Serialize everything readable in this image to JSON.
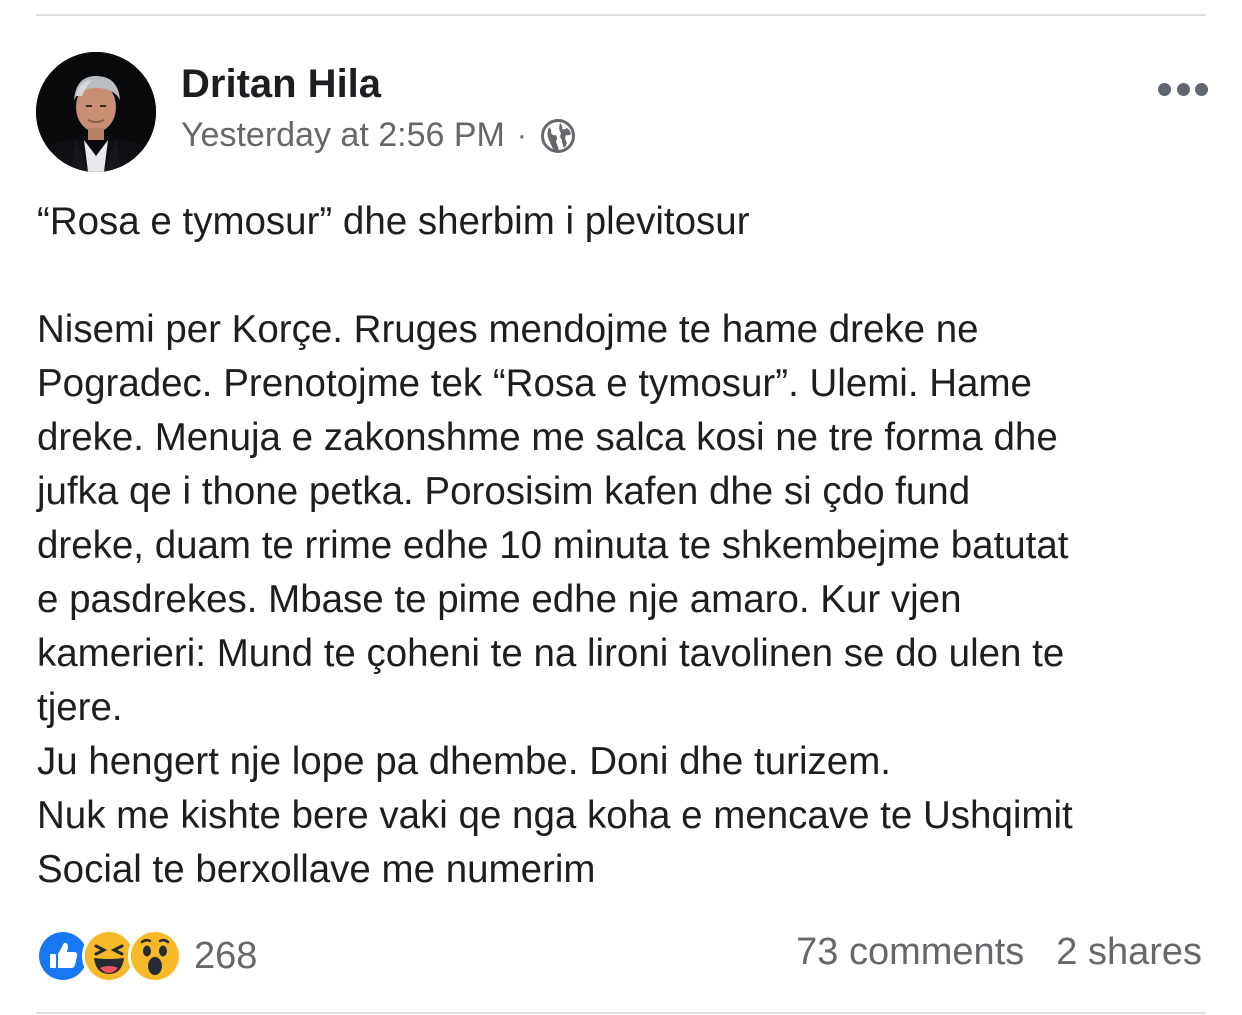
{
  "post": {
    "author": "Dritan Hila",
    "timestamp": "Yesterday at 2:56 PM",
    "separator": "·",
    "audience_icon": "globe-icon",
    "more_icon": "more-options-icon",
    "body": {
      "title_line": "“Rosa e tymosur” dhe sherbim i plevitosur",
      "lines": [
        "Nisemi per Korçe. Rruges mendojme te hame dreke ne",
        "Pogradec. Prenotojme tek “Rosa e tymosur”. Ulemi. Hame",
        "dreke. Menuja e zakonshme me salca kosi ne tre forma dhe",
        "jufka qe i thone petka. Porosisim kafen dhe si çdo fund",
        "dreke, duam te rrime edhe 10 minuta te shkembejme batutat",
        "e pasdrekes. Mbase te pime edhe nje amaro. Kur vjen",
        "kamerieri: Mund te çoheni te na lironi tavolinen se do ulen te",
        "tjere.",
        "Ju hengert nje lope pa dhembe. Doni dhe turizem.",
        "Nuk me kishte bere vaki qe nga koha e mencave te Ushqimit",
        "Social te berxollave me numerim"
      ]
    },
    "reactions": {
      "icons": [
        "like-icon",
        "haha-icon",
        "wow-icon"
      ],
      "count": "268"
    },
    "comments": "73 comments",
    "shares": "2 shares"
  },
  "colors": {
    "text_primary": "#1c1e21",
    "text_secondary": "#65676b",
    "like_blue": "#1877f2",
    "emoji_yellow": "#f7b928",
    "divider": "#dadde1"
  }
}
